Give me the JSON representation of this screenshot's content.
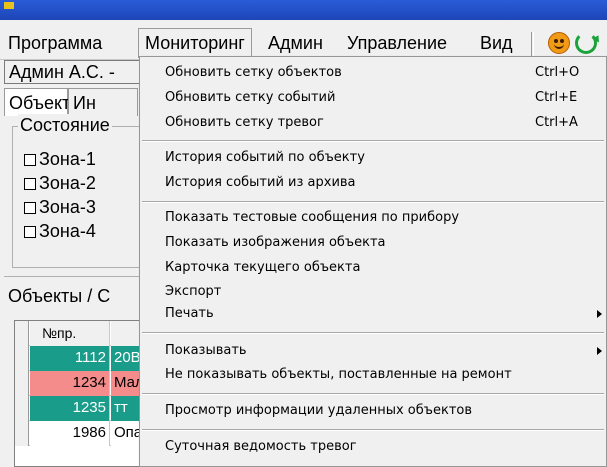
{
  "menubar": {
    "items": [
      "Программа",
      "Мониторинг",
      "Админ",
      "Управление",
      "Вид"
    ],
    "smile_icon": "smiley-icon",
    "refresh_icon": "refresh-icon"
  },
  "user": "Админ А.С. -",
  "tabs": [
    "Объект",
    "Ин"
  ],
  "state_group": {
    "title": "Состояние",
    "zones": [
      "Зона-1",
      "Зона-2",
      "Зона-3",
      "Зона-4"
    ]
  },
  "objects_panel": {
    "title": "Объекты / С",
    "header": "№пр.",
    "rows": [
      {
        "num": "1112",
        "name": "20В",
        "color": "#1a9c8a"
      },
      {
        "num": "1234",
        "name": "Мал",
        "color": "#f48c8c"
      },
      {
        "num": "1235",
        "name": "тт",
        "color": "#1a9c8a"
      },
      {
        "num": "1986",
        "name": "Опа",
        "color": "#ffffff"
      }
    ]
  },
  "dropdown": {
    "items": [
      {
        "label": "Обновить сетку объектов",
        "shortcut": "Ctrl+O"
      },
      {
        "label": "Обновить сетку событий",
        "shortcut": "Ctrl+E"
      },
      {
        "label": "Обновить сетку тревог",
        "shortcut": "Ctrl+A"
      },
      {
        "label": "История событий по объекту"
      },
      {
        "label": "История событий из архива"
      },
      {
        "label": "Показать тестовые сообщения по прибору"
      },
      {
        "label": "Показать изображения объекта"
      },
      {
        "label": "Карточка текущего объекта"
      },
      {
        "label": "Экспорт"
      },
      {
        "label": "Печать",
        "submenu": true
      },
      {
        "label": "Показывать",
        "submenu": true
      },
      {
        "label": "Не показывать объекты, поставленные на ремонт"
      },
      {
        "label": "Просмотр информации удаленных объектов"
      },
      {
        "label": "Суточная ведомость тревог"
      }
    ]
  }
}
